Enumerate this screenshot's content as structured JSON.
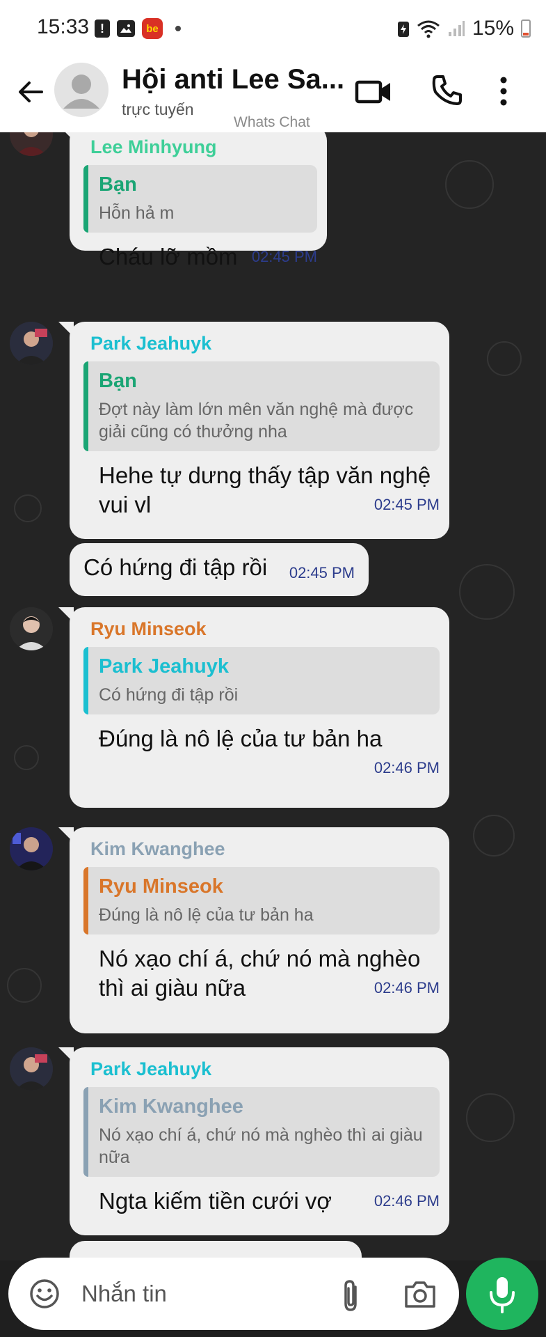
{
  "statusbar": {
    "time": "15:33",
    "battery": "15%",
    "icons": [
      "alert-icon",
      "image-icon",
      "be-app-icon",
      "dot-icon",
      "battery-saver-icon",
      "wifi-icon",
      "signal-icon",
      "battery-icon"
    ]
  },
  "header": {
    "title": "Hội anti Lee Sa...",
    "status": "trực tuyến",
    "watermark": "Whats Chat",
    "icons": [
      "back-arrow-icon",
      "avatar-placeholder",
      "video-call-icon",
      "phone-icon",
      "more-vert-icon"
    ]
  },
  "messages": [
    {
      "sender": "Lee Minhyung",
      "sender_color": "#3ecf98",
      "quote": {
        "author": "Bạn",
        "text": "Hỗn hả m",
        "color": "#1aa574"
      },
      "text": "Cháu lỡ mồm",
      "time": "02:45 PM"
    },
    {
      "sender": "Park Jeahuyk",
      "sender_color": "#1bbfd0",
      "quote": {
        "author": "Bạn",
        "text": "Đợt này làm lớn mên văn nghệ mà được giải cũng có thưởng nha",
        "color": "#1aa574"
      },
      "text": "Hehe tự dưng thấy tập văn nghệ vui vl",
      "time": "02:45 PM"
    },
    {
      "text": "Có hứng đi tập rồi",
      "time": "02:45 PM"
    },
    {
      "sender": "Ryu Minseok",
      "sender_color": "#d9762a",
      "quote": {
        "author": "Park Jeahuyk",
        "text": "Có hứng đi tập rồi",
        "color": "#1bbfd0"
      },
      "text": "Đúng là nô lệ của tư bản ha",
      "time": "02:46 PM"
    },
    {
      "sender": "Kim Kwanghee",
      "sender_color": "#8aa1b3",
      "quote": {
        "author": "Ryu Minseok",
        "text": "Đúng là nô lệ của tư bản ha",
        "color": "#d9762a"
      },
      "text": "Nó xạo chí á, chứ nó mà nghèo thì ai giàu nữa",
      "time": "02:46 PM"
    },
    {
      "sender": "Park Jeahuyk",
      "sender_color": "#1bbfd0",
      "quote": {
        "author": "Kim Kwanghee",
        "text": "Nó xạo chí á, chứ nó mà nghèo thì ai giàu nữa",
        "color": "#8aa1b3"
      },
      "text": "Ngta kiếm tiền cưới vợ",
      "time": "02:46 PM"
    }
  ],
  "composer": {
    "placeholder": "Nhắn tin",
    "icons": [
      "emoji-icon",
      "attach-icon",
      "camera-icon",
      "mic-icon"
    ]
  },
  "colors": {
    "accent_green": "#1fb55e",
    "chat_background": "#242424",
    "bubble": "#efefef",
    "time_text": "#2c3c8c"
  }
}
